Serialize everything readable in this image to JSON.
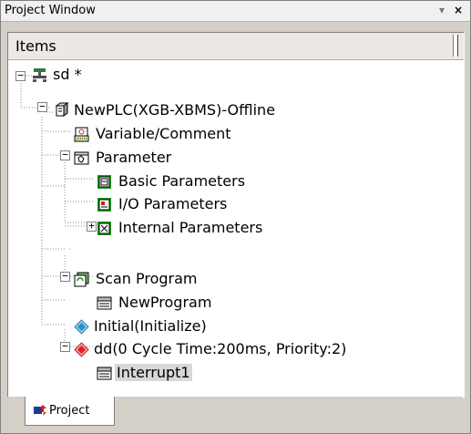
{
  "window": {
    "title": "Project Window",
    "pin_glyph": "▾",
    "close_glyph": "×"
  },
  "panel": {
    "header": "Items"
  },
  "tree": [
    {
      "id": "n0",
      "label": "sd *",
      "icon": "project-network-icon",
      "expander": "−"
    },
    {
      "id": "n1",
      "label": "NewPLC(XGB-XBMS)-Offline",
      "icon": "plc-cpu-icon",
      "expander": "−"
    },
    {
      "id": "n2",
      "label": "Variable/Comment",
      "icon": "variable-comment-icon"
    },
    {
      "id": "n3",
      "label": "Parameter",
      "icon": "parameter-folder-icon",
      "expander": "−"
    },
    {
      "id": "n4",
      "label": "Basic Parameters",
      "icon": "basic-parameter-icon"
    },
    {
      "id": "n5",
      "label": "I/O Parameters",
      "icon": "io-parameter-icon"
    },
    {
      "id": "n6",
      "label": "Internal Parameters",
      "icon": "internal-parameter-icon",
      "expander": "+"
    },
    {
      "id": "n7",
      "label": "Scan Program",
      "icon": "scan-program-icon",
      "expander": "−"
    },
    {
      "id": "n8",
      "label": "NewProgram",
      "icon": "program-icon"
    },
    {
      "id": "n9",
      "label": "Initial(Initialize)",
      "icon": "initial-task-icon"
    },
    {
      "id": "n10",
      "label": "dd(0 Cycle Time:200ms, Priority:2)",
      "icon": "cyclic-task-icon",
      "expander": "−"
    },
    {
      "id": "n11",
      "label": "Interrupt1",
      "icon": "program-icon",
      "selected": true
    }
  ],
  "tabs": {
    "project": "Project"
  }
}
